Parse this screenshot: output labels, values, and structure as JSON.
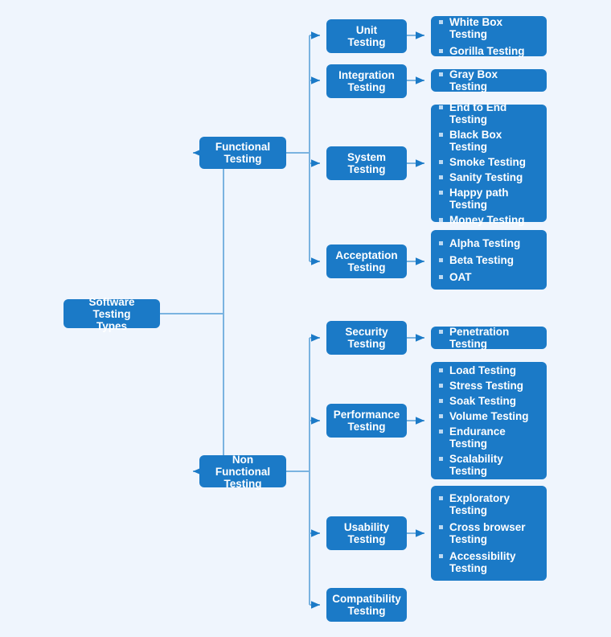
{
  "theme": {
    "background": "#eff5fd",
    "node_fill": "#1b7ac7",
    "node_text": "#ffffff",
    "connector": "#7ab3e0",
    "arrow": "#1b7ac7",
    "bullet": "#bcd9f2"
  },
  "root": {
    "label": "Software Testing\nTypes"
  },
  "branches": [
    {
      "label": "Functional\nTesting",
      "children": [
        {
          "label": "Unit\nTesting",
          "leaves": [
            "White Box Testing",
            "Gorilla Testing"
          ]
        },
        {
          "label": "Integration\nTesting",
          "leaves": [
            "Gray Box Testing"
          ]
        },
        {
          "label": "System\nTesting",
          "leaves": [
            "End to End Testing",
            "Black Box Testing",
            "Smoke Testing",
            "Sanity Testing",
            "Happy path Testing",
            "Money Testing"
          ]
        },
        {
          "label": "Acceptation\nTesting",
          "leaves": [
            "Alpha Testing",
            "Beta Testing",
            "OAT"
          ]
        }
      ]
    },
    {
      "label": "Non Functional\nTesting",
      "children": [
        {
          "label": "Security\nTesting",
          "leaves": [
            "Penetration Testing"
          ]
        },
        {
          "label": "Performance\nTesting",
          "leaves": [
            "Load Testing",
            "Stress Testing",
            "Soak Testing",
            "Volume Testing",
            "Endurance Testing",
            "Scalability Testing"
          ]
        },
        {
          "label": "Usability\nTesting",
          "leaves": [
            "Exploratory\nTesting",
            "Cross browser\nTesting",
            "Accessibility\nTesting"
          ]
        },
        {
          "label": "Compatibility\nTesting",
          "leaves": []
        }
      ]
    }
  ]
}
